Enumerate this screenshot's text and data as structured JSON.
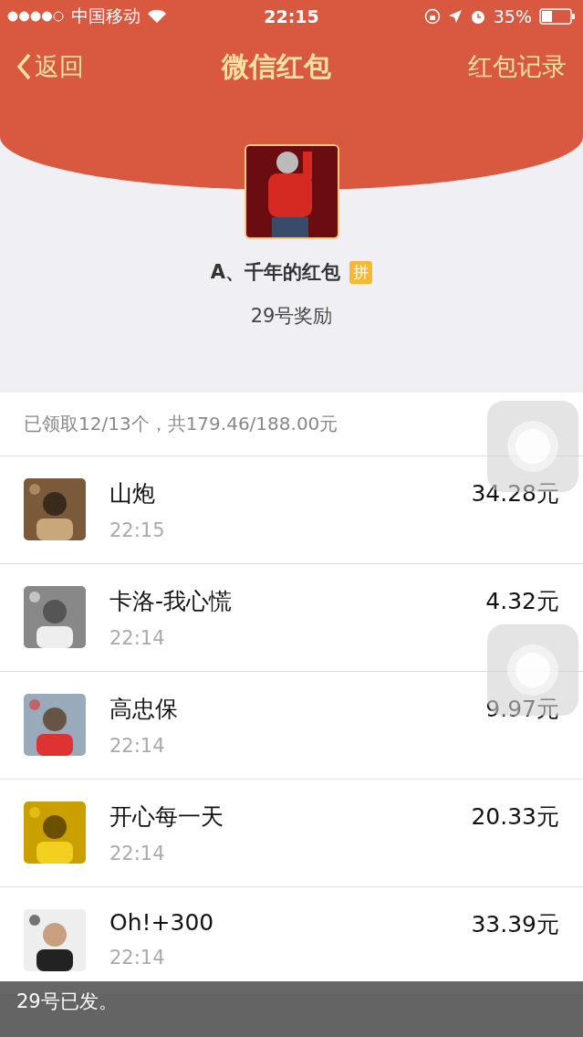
{
  "status_bar": {
    "carrier": "中国移动",
    "time": "22:15",
    "battery": "35%"
  },
  "nav": {
    "back": "返回",
    "title": "微信红包",
    "right": "红包记录"
  },
  "packet": {
    "sender": "A、千年的红包",
    "badge": "拼",
    "message": "29号奖励"
  },
  "summary": "已领取12/13个，共179.46/188.00元",
  "records": [
    {
      "name": "山炮",
      "time": "22:15",
      "amount": "34.28元"
    },
    {
      "name": "卡洛-我心慌",
      "time": "22:14",
      "amount": "4.32元"
    },
    {
      "name": "高忠保",
      "time": "22:14",
      "amount": "9.97元"
    },
    {
      "name": "开心每一天",
      "time": "22:14",
      "amount": "20.33元"
    },
    {
      "name": "Oh!+300",
      "time": "22:14",
      "amount": "33.39元"
    }
  ],
  "toast": "29号已发。"
}
